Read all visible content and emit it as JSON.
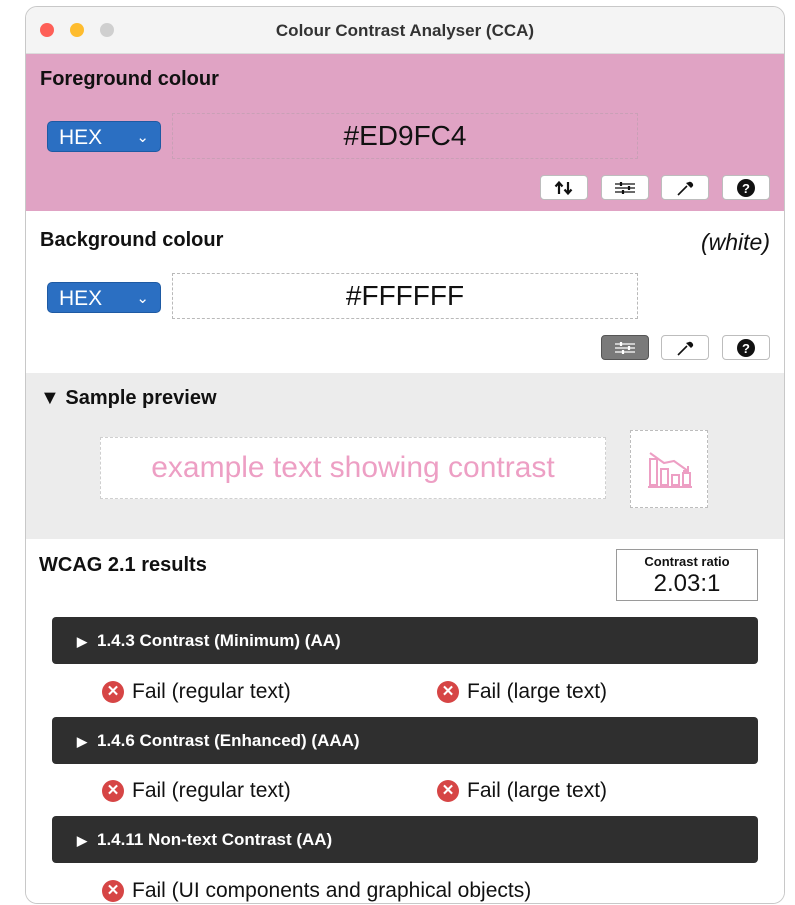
{
  "window": {
    "title": "Colour Contrast Analyser (CCA)"
  },
  "foreground": {
    "heading": "Foreground colour",
    "format": "HEX",
    "value": "#ED9FC4",
    "color": "#ED9FC4",
    "buttons": [
      "swap-icon",
      "sliders-icon",
      "eyedropper-icon",
      "help-icon"
    ]
  },
  "background": {
    "heading": "Background colour",
    "name": "(white)",
    "format": "HEX",
    "value": "#FFFFFF",
    "color": "#FFFFFF",
    "buttons": [
      "sliders-icon",
      "eyedropper-icon",
      "help-icon"
    ]
  },
  "preview": {
    "heading": "Sample preview",
    "sample_text": "example text showing contrast"
  },
  "results": {
    "heading": "WCAG 2.1 results",
    "ratio_label": "Contrast ratio",
    "ratio_value": "2.03:1",
    "criteria": [
      {
        "title": "1.4.3 Contrast (Minimum) (AA)",
        "results": [
          "Fail (regular text)",
          "Fail (large text)"
        ]
      },
      {
        "title": "1.4.6 Contrast (Enhanced) (AAA)",
        "results": [
          "Fail (regular text)",
          "Fail (large text)"
        ]
      },
      {
        "title": "1.4.11 Non-text Contrast (AA)",
        "results": [
          "Fail (UI components and graphical objects)"
        ]
      }
    ],
    "fail_color": "#D64545"
  }
}
